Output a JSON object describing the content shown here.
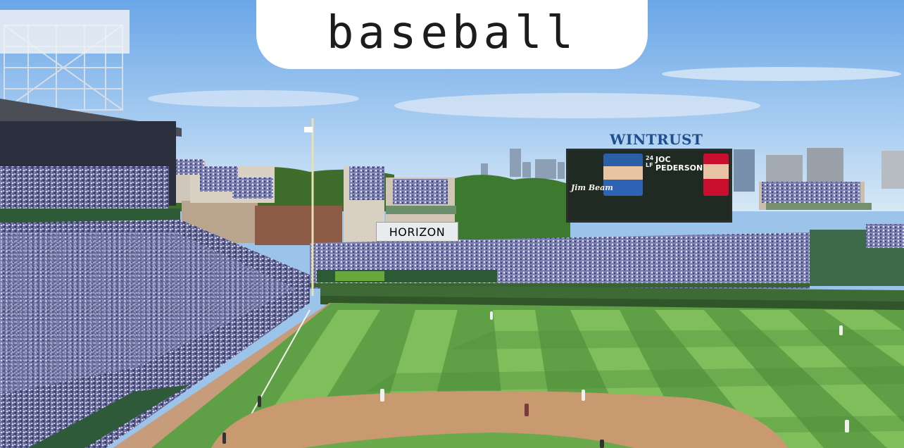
{
  "caption": "baseball",
  "scoreboard": {
    "sponsor": "WINTRUST",
    "player_number": "24",
    "player_position": "LF",
    "player_name_line1": "JOC",
    "player_name_line2": "PEDERSON",
    "brand": "Jim Beam"
  },
  "signage": {
    "building_sign": "HORIZON"
  },
  "colors": {
    "sky": "#9cc3ea",
    "grass_light": "#6fae53",
    "grass_dark": "#4e8f3b",
    "infield_dirt": "#c89a74",
    "ivy_wall": "#3f6b37",
    "crowd": "#5b5e86"
  }
}
